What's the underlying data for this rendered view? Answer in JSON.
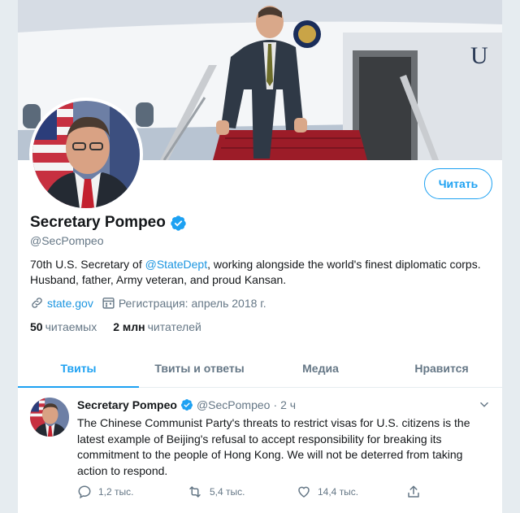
{
  "profile": {
    "name": "Secretary Pompeo",
    "handle": "@SecPompeo",
    "follow_label": "Читать",
    "bio_prefix": "70th U.S. Secretary of ",
    "bio_mention": "@StateDept",
    "bio_suffix": ", working alongside the world's finest diplomatic corps. Husband, father, Army veteran, and proud Kansan.",
    "website": "state.gov",
    "joined": "Регистрация: апрель 2018 г.",
    "following_count": "50",
    "following_label": "читаемых",
    "followers_count": "2 млн",
    "followers_label": "читателей"
  },
  "tabs": [
    {
      "label": "Твиты",
      "active": true
    },
    {
      "label": "Твиты и ответы",
      "active": false
    },
    {
      "label": "Медиа",
      "active": false
    },
    {
      "label": "Нравится",
      "active": false
    }
  ],
  "tweet": {
    "name": "Secretary Pompeo",
    "handle": "@SecPompeo",
    "dot": "·",
    "time": "2 ч",
    "text": "The Chinese Communist Party's threats to restrict visas for U.S. citizens is the latest example of Beijing's refusal to accept responsibility for breaking its commitment to the people of Hong Kong. We will not be deterred from taking action to respond.",
    "replies": "1,2 тыс.",
    "retweets": "5,4 тыс.",
    "likes": "14,4 тыс."
  },
  "colors": {
    "accent": "#1da1f2",
    "link": "#1b95e0",
    "muted": "#657786",
    "text": "#14171a",
    "retweet_icon": "#17bf63"
  },
  "icons": [
    "verified-badge-icon",
    "link-icon",
    "calendar-icon",
    "reply-icon",
    "retweet-icon",
    "like-icon",
    "share-icon",
    "chevron-down-icon"
  ]
}
